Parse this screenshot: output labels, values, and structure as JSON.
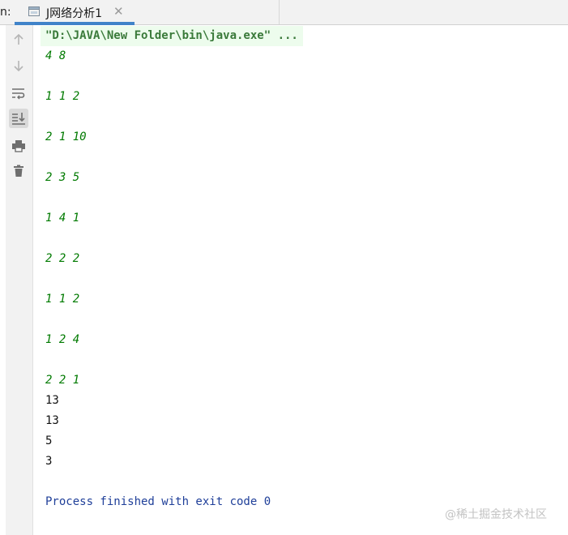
{
  "run_label": "n:",
  "tab": {
    "title": "J网络分析1",
    "close_glyph": "✕",
    "icon": "application-icon"
  },
  "toolbar": {
    "items": [
      {
        "name": "up-arrow-icon",
        "active": false
      },
      {
        "name": "down-arrow-icon",
        "active": false
      },
      {
        "name": "soft-wrap-icon",
        "active": false
      },
      {
        "name": "scroll-to-end-icon",
        "active": true
      },
      {
        "name": "print-icon",
        "active": false
      },
      {
        "name": "trash-icon",
        "active": false
      }
    ]
  },
  "console": {
    "command": "\"D:\\JAVA\\New Folder\\bin\\java.exe\" ...",
    "input_lines": [
      "4 8",
      "1 1 2",
      "2 1 10",
      "2 3 5",
      "1 4 1",
      "2 2 2",
      "1 1 2",
      "1 2 4",
      "2 2 1"
    ],
    "output_lines": [
      "13",
      "13",
      "5",
      "3"
    ],
    "exit_message": "Process finished with exit code 0"
  },
  "watermark": "@稀土掘金技术社区",
  "colors": {
    "accent": "#4083c9",
    "input_text": "#007a00",
    "command_bg": "#edfced",
    "exit_text": "#1f3f99"
  }
}
